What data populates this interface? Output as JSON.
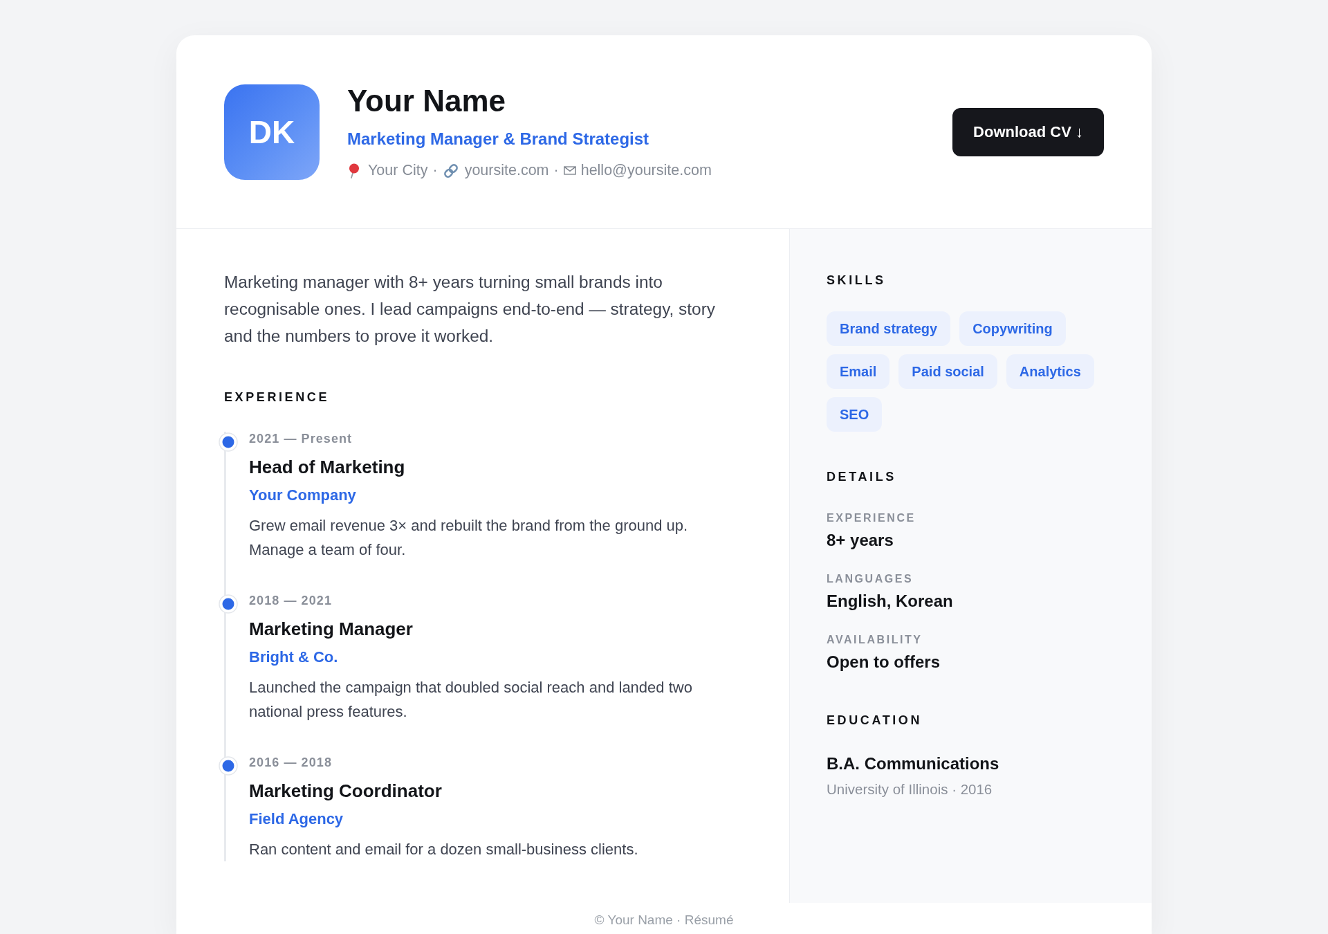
{
  "header": {
    "avatar_initials": "DK",
    "name": "Your Name",
    "headline": "Marketing Manager & Brand Strategist",
    "contacts": [
      {
        "kind": "location",
        "text": "Your City"
      },
      {
        "kind": "separator",
        "text": "·"
      },
      {
        "kind": "website",
        "text": "yoursite.com"
      },
      {
        "kind": "separator",
        "text": "·"
      },
      {
        "kind": "email",
        "text": "hello@yoursite.com"
      }
    ],
    "download_button": "Download CV ↓"
  },
  "summary": "Marketing manager with 8+ years turning small brands into recognisable ones. I lead campaigns end-to-end — strategy, story and the numbers to prove it worked.",
  "experience": {
    "heading": "EXPERIENCE",
    "jobs": [
      {
        "dates": "2021 — Present",
        "title": "Head of Marketing",
        "company": "Your Company",
        "description": "Grew email revenue 3× and rebuilt the brand from the ground up. Manage a team of four."
      },
      {
        "dates": "2018 — 2021",
        "title": "Marketing Manager",
        "company": "Bright & Co.",
        "description": "Launched the campaign that doubled social reach and landed two national press features."
      },
      {
        "dates": "2016 — 2018",
        "title": "Marketing Coordinator",
        "company": "Field Agency",
        "description": "Ran content and email for a dozen small-business clients."
      }
    ]
  },
  "sidebar": {
    "skills": {
      "heading": "SKILLS",
      "tags": [
        "Brand strategy",
        "Copywriting",
        "Email",
        "Paid social",
        "Analytics",
        "SEO"
      ]
    },
    "details": {
      "heading": "DETAILS",
      "items": [
        {
          "label": "EXPERIENCE",
          "value": "8+ years"
        },
        {
          "label": "LANGUAGES",
          "value": "English, Korean"
        },
        {
          "label": "AVAILABILITY",
          "value": "Open to offers"
        }
      ]
    },
    "education": {
      "heading": "EDUCATION",
      "entries": [
        {
          "degree": "B.A. Communications",
          "school": "University of Illinois · 2016"
        }
      ]
    }
  },
  "footer": "© Your Name · Résumé"
}
